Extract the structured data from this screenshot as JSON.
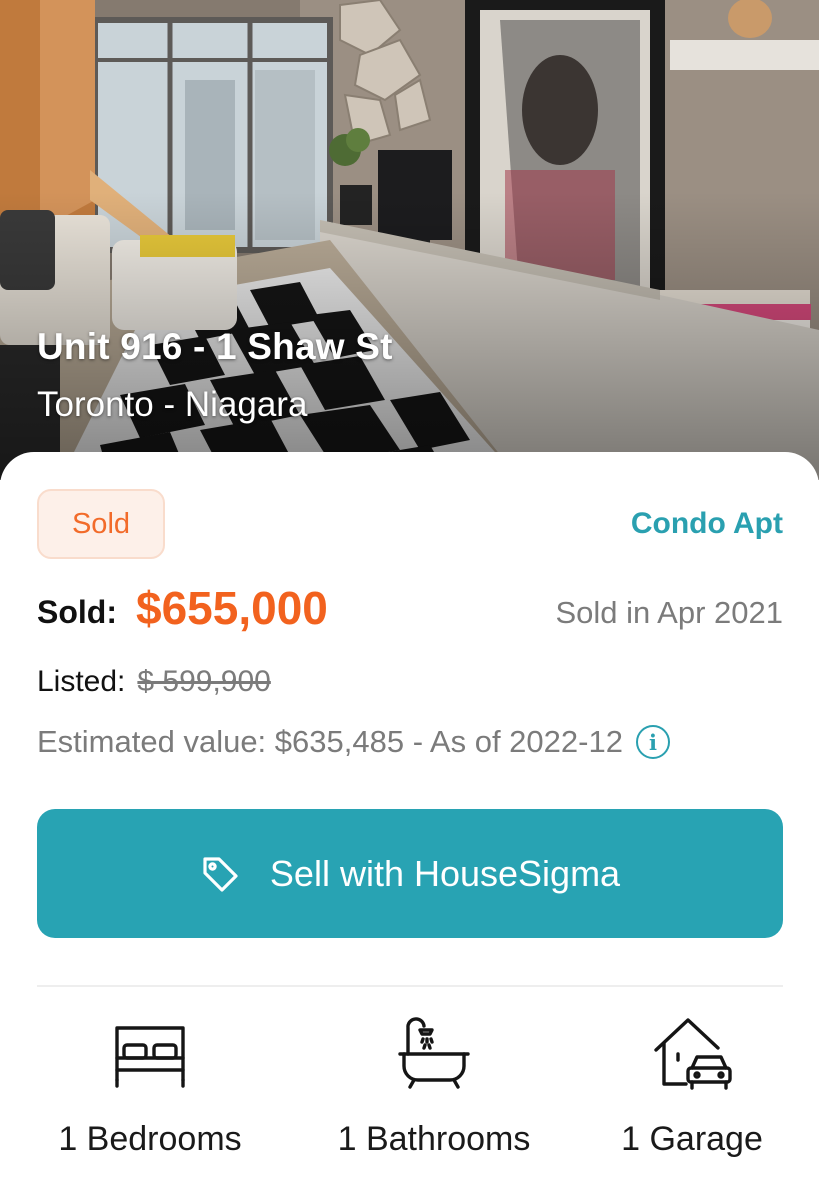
{
  "listing": {
    "title": "Unit 916 - 1 Shaw St",
    "subtitle": "Toronto - Niagara",
    "status_badge": "Sold",
    "property_type": "Condo Apt",
    "sold_label": "Sold:",
    "sold_price": "$655,000",
    "sold_date": "Sold in Apr 2021",
    "listed_label": "Listed:",
    "listed_price": "$ 599,900",
    "estimated_value": "Estimated value: $635,485 - As of 2022-12"
  },
  "actions": {
    "sell_label": "Sell with HouseSigma"
  },
  "features": [
    {
      "icon": "bed-icon",
      "label": "1 Bedrooms"
    },
    {
      "icon": "bathtub-icon",
      "label": "1 Bathrooms"
    },
    {
      "icon": "garage-icon",
      "label": "1 Garage"
    }
  ],
  "colors": {
    "accent_teal": "#28a3b3",
    "sold_orange": "#f2621e",
    "badge_bg": "#fdf0e9",
    "muted_text": "#7b7b7b"
  }
}
